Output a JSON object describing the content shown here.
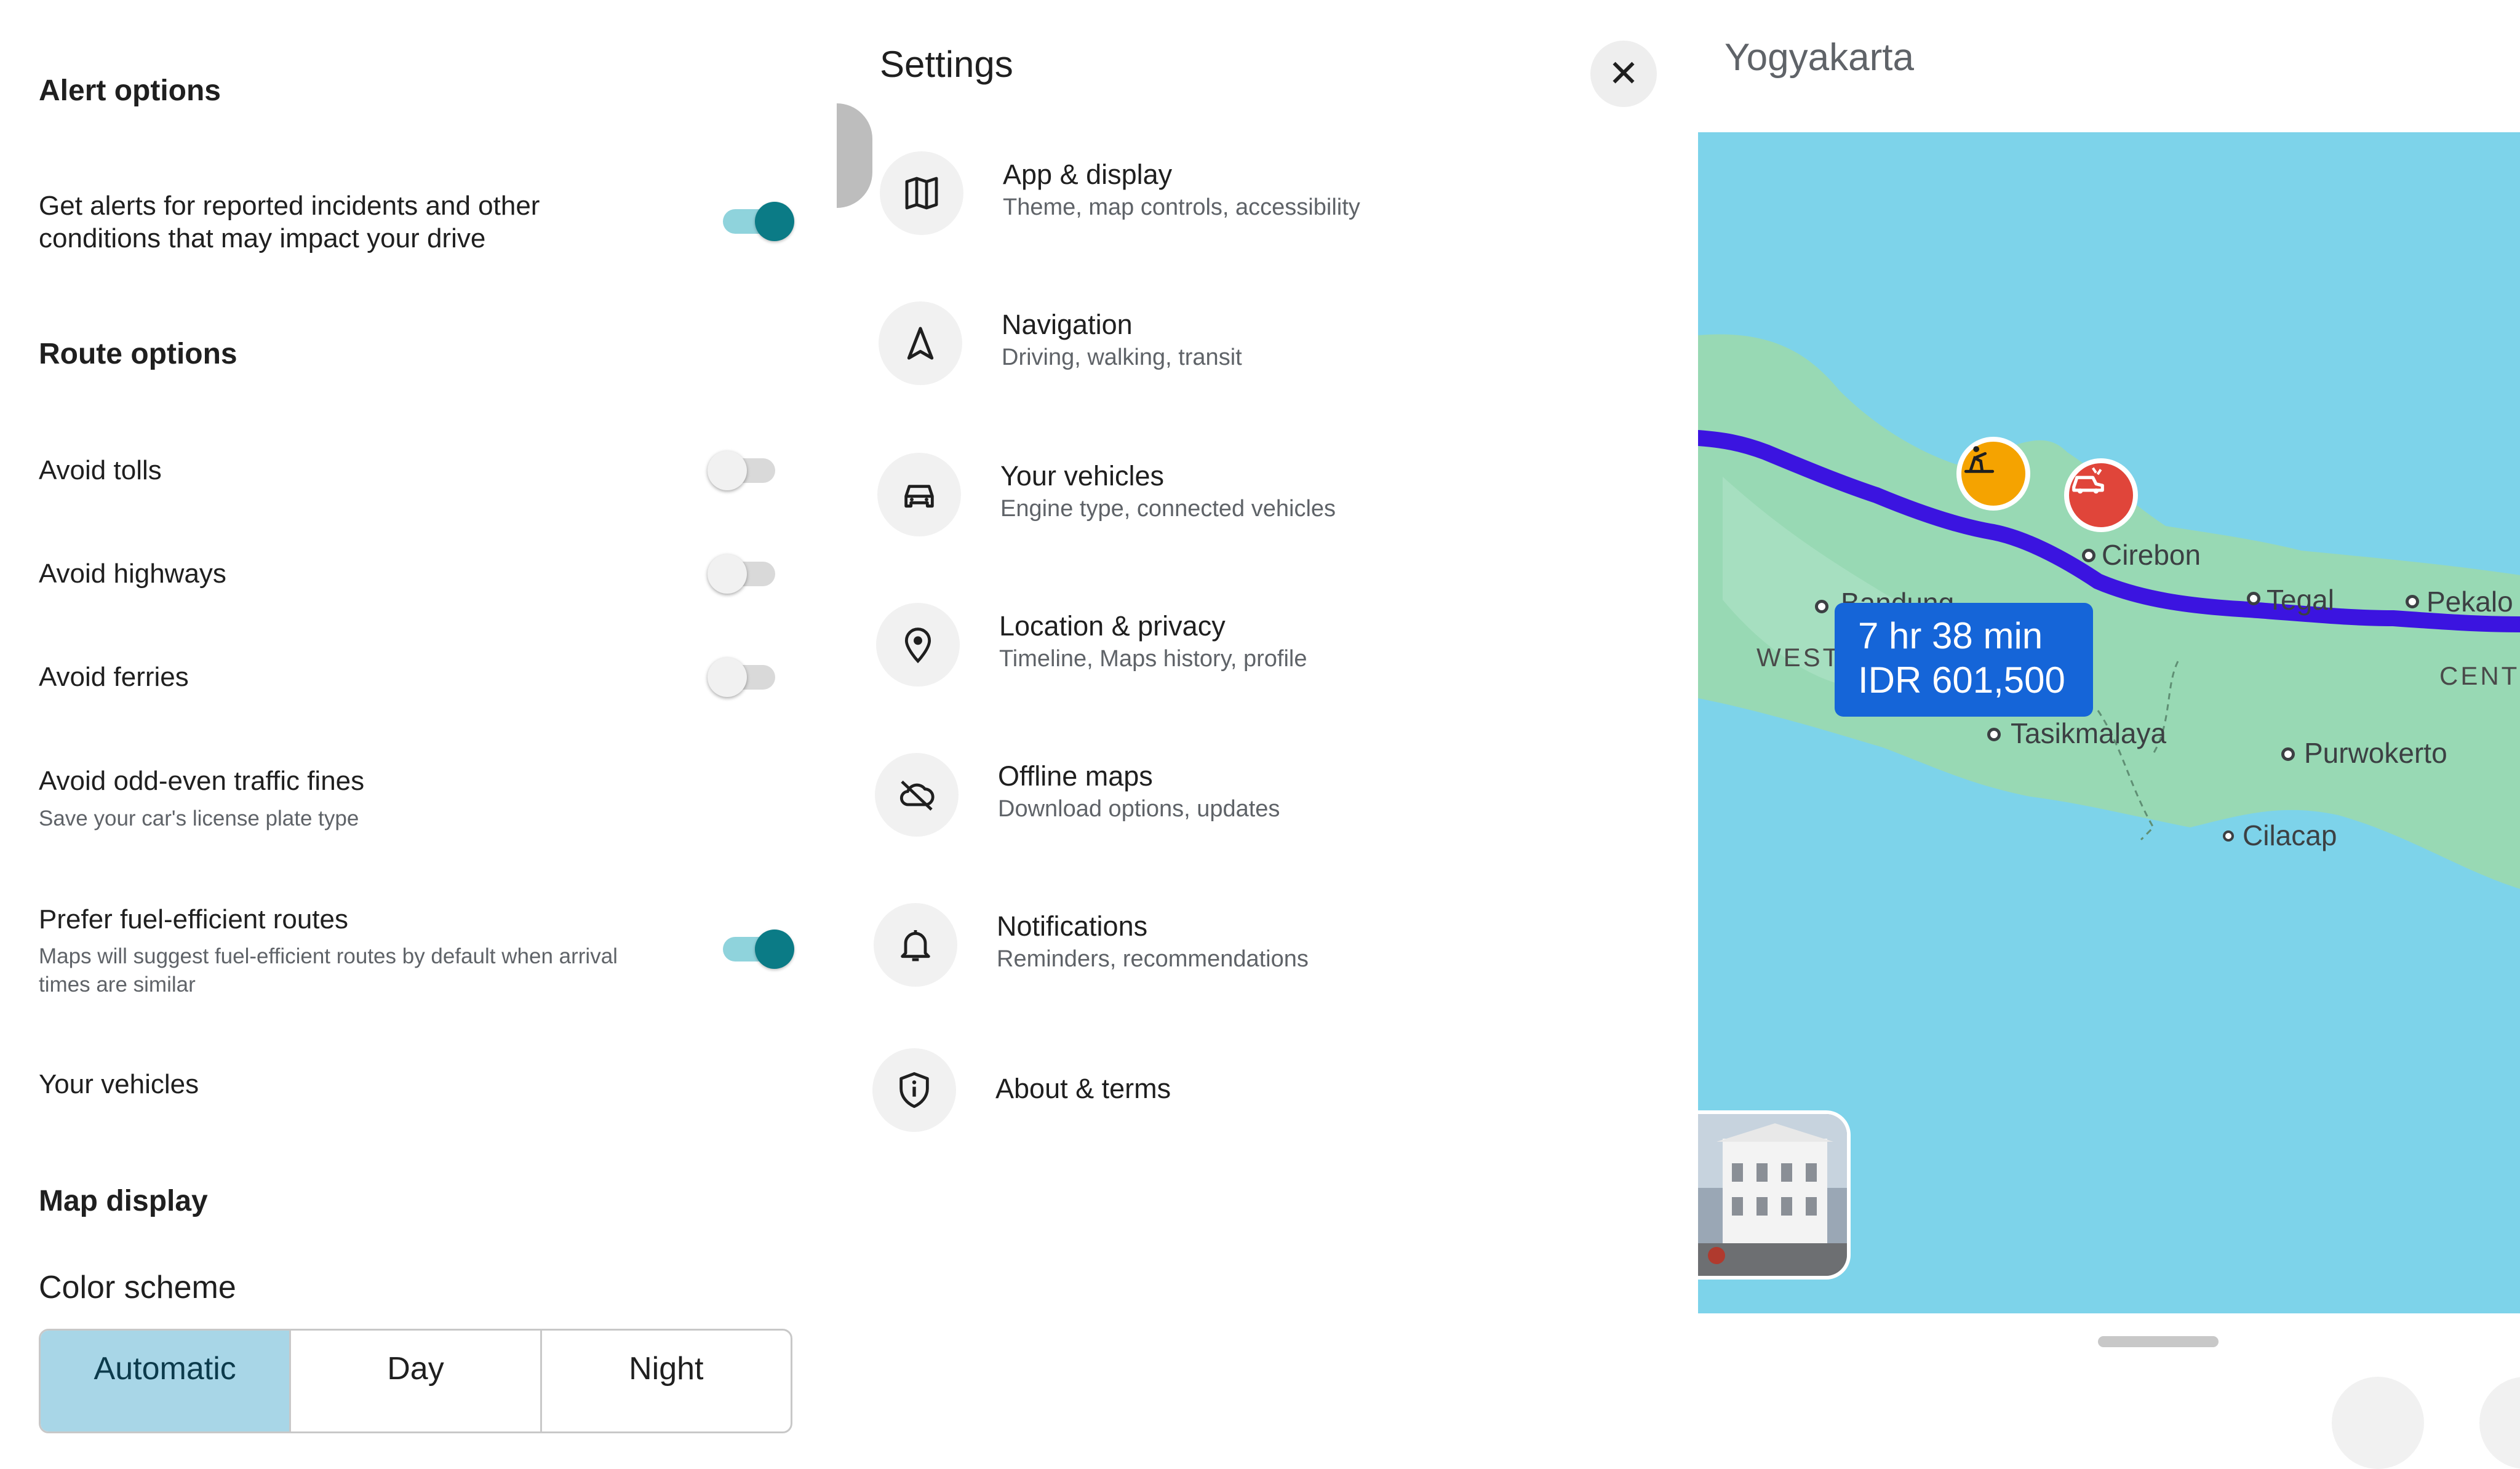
{
  "alert_options": {
    "heading": "Alert options",
    "incidents_label": "Get alerts for reported incidents and other conditions that may impact your drive",
    "incidents_on": true
  },
  "route_options": {
    "heading": "Route options",
    "avoid_tolls": "Avoid tolls",
    "avoid_highways": "Avoid highways",
    "avoid_ferries": "Avoid ferries",
    "odd_even_title": "Avoid odd-even traffic fines",
    "odd_even_sub": "Save your car's license plate type",
    "fuel_title": "Prefer fuel-efficient routes",
    "fuel_sub": "Maps will suggest fuel-efficient routes by default when arrival times are similar",
    "your_vehicles": "Your vehicles"
  },
  "map_display": {
    "heading": "Map display",
    "color_scheme_label": "Color scheme",
    "schemes": [
      "Automatic",
      "Day",
      "Night"
    ],
    "selected": "Automatic"
  },
  "settings": {
    "title": "Settings",
    "close_glyph": "✕",
    "items": [
      {
        "title": "App & display",
        "sub": "Theme, map controls, accessibility",
        "icon": "map-icon"
      },
      {
        "title": "Navigation",
        "sub": "Driving, walking, transit",
        "icon": "navigation-arrow-icon"
      },
      {
        "title": "Your vehicles",
        "sub": "Engine type, connected vehicles",
        "icon": "car-icon"
      },
      {
        "title": "Location & privacy",
        "sub": "Timeline, Maps history, profile",
        "icon": "location-pin-icon"
      },
      {
        "title": "Offline maps",
        "sub": "Download options, updates",
        "icon": "cloud-off-icon"
      },
      {
        "title": "Notifications",
        "sub": "Reminders, recommendations",
        "icon": "bell-icon"
      },
      {
        "title": "About & terms",
        "sub": "",
        "icon": "shield-info-icon"
      }
    ]
  },
  "map": {
    "destination": "Yogyakarta",
    "eta_time": "7 hr 38 min",
    "eta_cost": "IDR 601,500",
    "cities": [
      "Cirebon",
      "Tegal",
      "Pekalo",
      "Tasikmalaya",
      "Purwokerto",
      "Cilacap",
      "Bandung"
    ],
    "regions": [
      "WEST",
      "CENT"
    ],
    "colors": {
      "sea": "#7dd3ea",
      "land": "#98d9b4",
      "route": "#3b14e0",
      "eta_box": "#1565d8"
    }
  }
}
